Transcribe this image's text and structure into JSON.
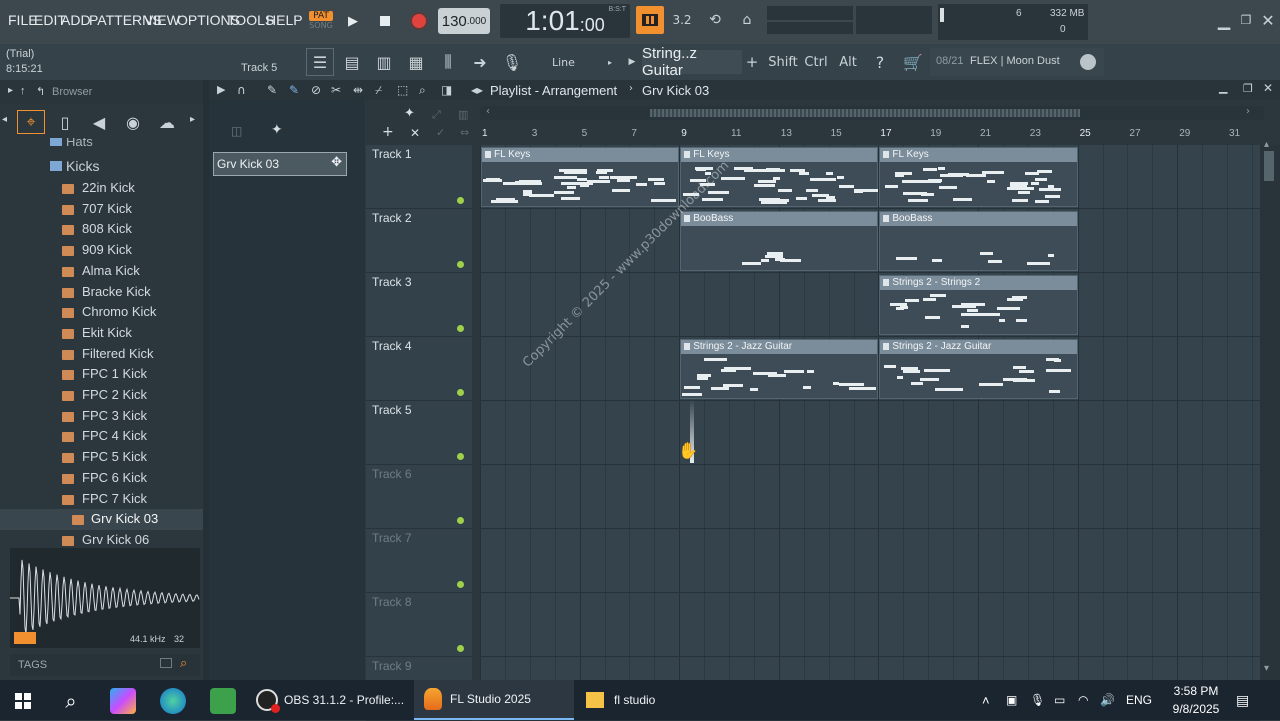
{
  "menu": [
    "FILE",
    "EDIT",
    "ADD",
    "PATTERNS",
    "VIEW",
    "OPTIONS",
    "TOOLS",
    "HELP"
  ],
  "transport": {
    "pat": "PAT",
    "song": "SONG",
    "tempo": "130",
    "tempo_dec": ".000",
    "time": "1:01",
    "time_sub": ":00",
    "bst": "B:S:T"
  },
  "meters": {
    "cpu_val": "6",
    "mem": "332 MB",
    "poly": "0"
  },
  "status": {
    "mode": "(Trial)",
    "time": "8:15:21",
    "track": "Track 5"
  },
  "snap": "Line",
  "channel": "String..z Guitar",
  "keys": [
    "Shift",
    "Ctrl",
    "Alt"
  ],
  "news": {
    "date": "08/21",
    "text": "FLEX | Moon Dust"
  },
  "browser": {
    "title": "Browser",
    "parent": "Hats",
    "folder": "Kicks",
    "items": [
      "22in Kick",
      "707 Kick",
      "808 Kick",
      "909 Kick",
      "Alma Kick",
      "Bracke Kick",
      "Chromo Kick",
      "Ekit Kick",
      "Filtered Kick",
      "FPC 1 Kick",
      "FPC 2 Kick",
      "FPC 3 Kick",
      "FPC 4 Kick",
      "FPC 5 Kick",
      "FPC 6 Kick",
      "FPC 7 Kick",
      "Grv Kick 03",
      "Grv Kick 06"
    ],
    "selected": "Grv Kick 03",
    "sample_rate": "44.1 kHz",
    "bits": "32",
    "tags": "TAGS"
  },
  "pattern_picker": {
    "current": "Grv Kick 03"
  },
  "playlist": {
    "title": "Playlist - Arrangement",
    "breadcrumb": "Grv Kick 03",
    "tracks": [
      "Track 1",
      "Track 2",
      "Track 3",
      "Track 4",
      "Track 5",
      "Track 6",
      "Track 7",
      "Track 8",
      "Track 9"
    ],
    "bars": [
      "1",
      "3",
      "5",
      "7",
      "9",
      "11",
      "13",
      "15",
      "17",
      "19",
      "21",
      "23",
      "25",
      "27",
      "29",
      "31"
    ],
    "clips": [
      {
        "track": 0,
        "start": 1,
        "len": 8,
        "name": "FL Keys"
      },
      {
        "track": 0,
        "start": 9,
        "len": 8,
        "name": "FL Keys"
      },
      {
        "track": 0,
        "start": 17,
        "len": 8,
        "name": "FL Keys"
      },
      {
        "track": 1,
        "start": 9,
        "len": 8,
        "name": "BooBass"
      },
      {
        "track": 1,
        "start": 17,
        "len": 8,
        "name": "BooBass"
      },
      {
        "track": 2,
        "start": 17,
        "len": 8,
        "name": "Strings 2 - Strings 2"
      },
      {
        "track": 3,
        "start": 9,
        "len": 8,
        "name": "Strings 2 - Jazz Guitar"
      },
      {
        "track": 3,
        "start": 17,
        "len": 8,
        "name": "Strings 2 - Jazz Guitar"
      }
    ],
    "watermark": "Copyright © 2025 - www.p30download.com"
  },
  "taskbar": {
    "items": [
      "OBS 31.1.2 - Profile:...",
      "FL Studio 2025",
      "fl studio"
    ],
    "lang": "ENG",
    "time": "3:58 PM",
    "date": "9/8/2025"
  },
  "colors": {
    "accent": "#f28f2f",
    "record": "#e0433e",
    "green": "#9ed14b",
    "clip_header": "#7b8c9a"
  }
}
